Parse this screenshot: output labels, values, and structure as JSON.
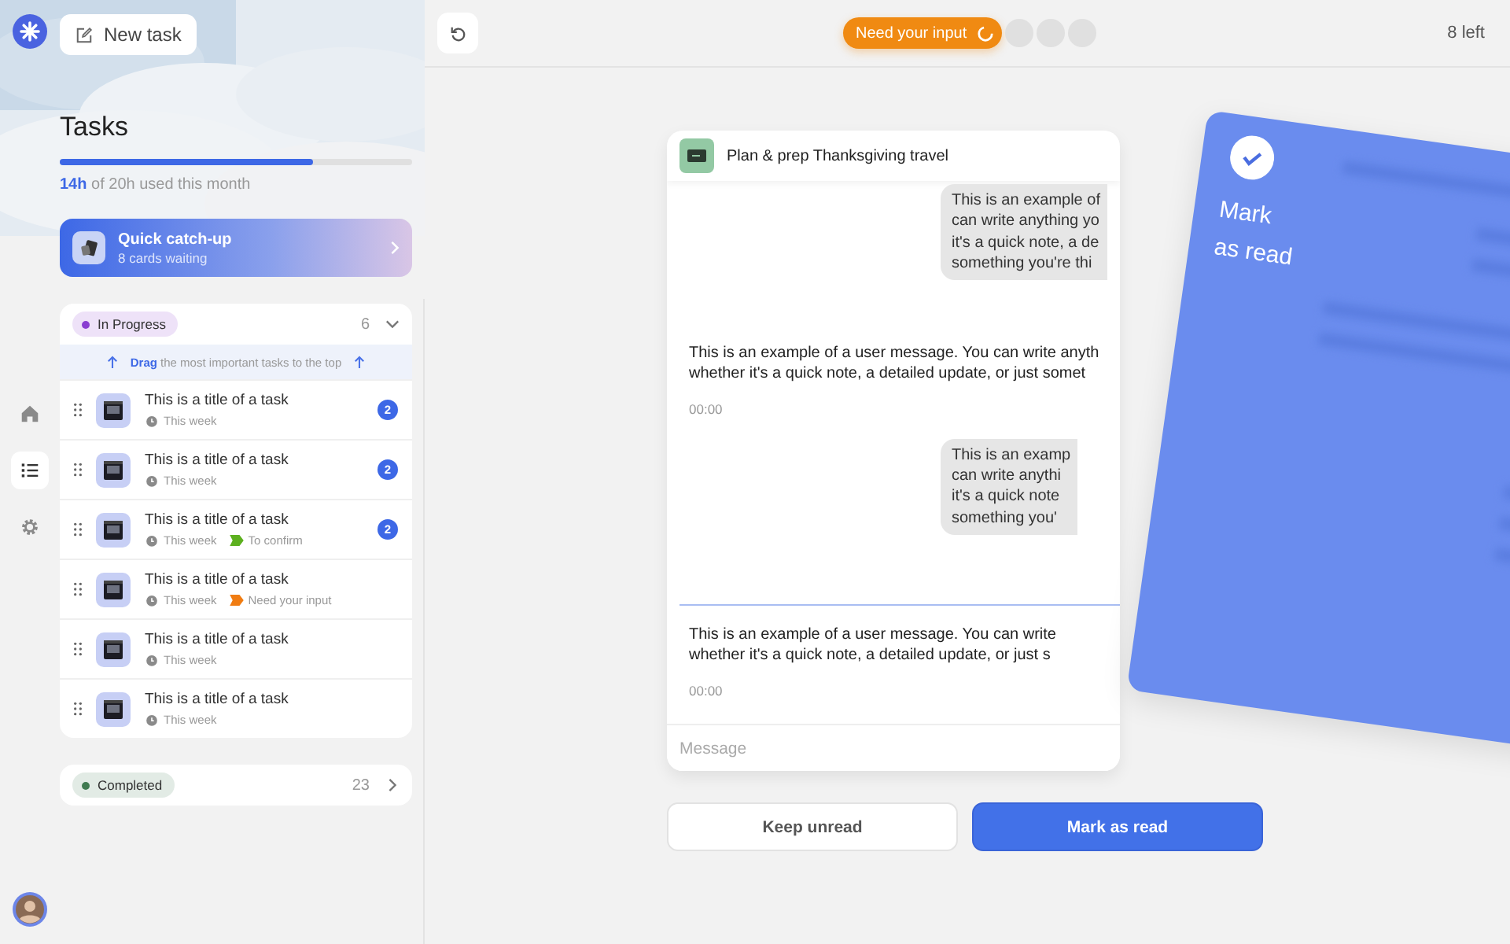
{
  "sidebar": {
    "new_task_button": "New task",
    "nav": [
      {
        "kind": "home",
        "selected": false
      },
      {
        "kind": "list",
        "selected": true
      },
      {
        "kind": "settings",
        "selected": false
      }
    ],
    "title": "Tasks",
    "usage": {
      "level": 0.72,
      "text": "**14h** of 20h used this month"
    },
    "catch_up": {
      "title": "Quick catch-up",
      "subtitle": "8 cards waiting"
    },
    "groups": [
      {
        "label": "In Progress",
        "color": "#8a3fd1",
        "count": "6",
        "expanded": true,
        "hint": "**Drag** the most important tasks to the top",
        "tasks": [
          {
            "title": "This is a title of a task",
            "due": "This week",
            "badge": "2"
          },
          {
            "title": "This is a title of a task",
            "due": "This week",
            "badge": "2"
          },
          {
            "title": "This is a title of a task",
            "due": "This week",
            "badge": "2",
            "status": {
              "label": "To confirm",
              "color": "#5db01f"
            }
          },
          {
            "title": "This is a title of a task",
            "due": "This week",
            "status": {
              "label": "Need your input",
              "color": "#f07c12"
            }
          },
          {
            "title": "This is a title of a task",
            "due": "This week"
          },
          {
            "title": "This is a title of a task",
            "due": "This week"
          }
        ]
      },
      {
        "label": "Completed",
        "color": "#3f7a50",
        "count": "23",
        "expanded": false
      }
    ]
  },
  "topbar": {
    "status_pill": "Need your input",
    "remaining": "8 left"
  },
  "chat": {
    "title": "Plan & prep Thanksgiving travel",
    "messages": [
      {
        "kind": "bubble",
        "unread": false,
        "lines": [
          "This is an example of",
          "can write anything yo",
          "it's a quick note, a de",
          "something you're thi"
        ]
      },
      {
        "kind": "plain",
        "unread": false,
        "lines": [
          "This is an example of a user message. You can write anyth",
          "whether it's a quick note, a detailed update, or just somet"
        ],
        "time": "00:00"
      },
      {
        "kind": "bubble",
        "unread": false,
        "lines": [
          "This is an examp",
          "can write anythi",
          "it's a quick note",
          "something you'"
        ]
      },
      {
        "kind": "plain",
        "unread": true,
        "lines": [
          "This is an example of a user message. You can write",
          "whether it's a quick note, a detailed update, or just s"
        ],
        "time": "00:00"
      }
    ],
    "input": {
      "placeholder": "Message"
    }
  },
  "swipe_card": {
    "label": "Mark\nas read"
  },
  "buttons": [
    {
      "label": "Keep unread",
      "kind": "secondary"
    },
    {
      "label": "Mark as read",
      "kind": "primary"
    }
  ]
}
